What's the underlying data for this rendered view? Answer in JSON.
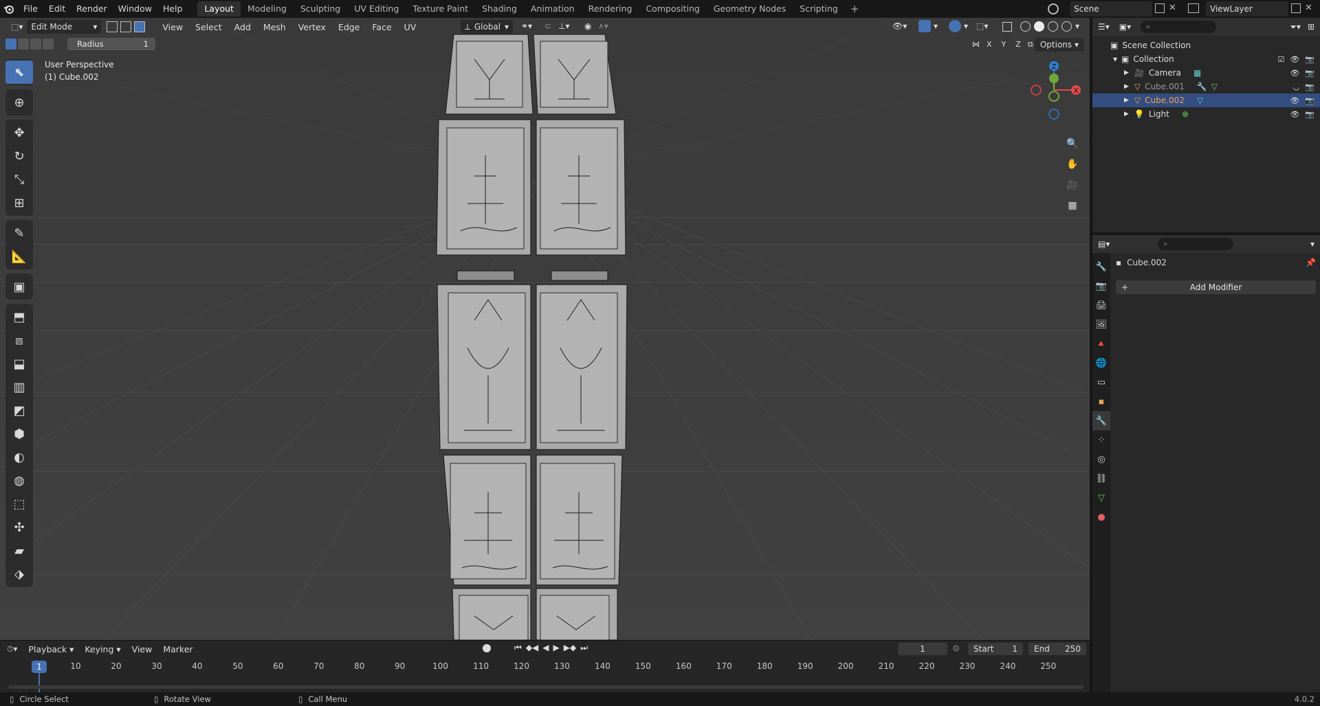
{
  "topbar": {
    "menus": [
      "File",
      "Edit",
      "Render",
      "Window",
      "Help"
    ],
    "workspaces": [
      "Layout",
      "Modeling",
      "Sculpting",
      "UV Editing",
      "Texture Paint",
      "Shading",
      "Animation",
      "Rendering",
      "Compositing",
      "Geometry Nodes",
      "Scripting"
    ],
    "active_workspace": "Layout",
    "scene": "Scene",
    "view_layer": "ViewLayer"
  },
  "viewport": {
    "mode": "Edit Mode",
    "menus": [
      "View",
      "Select",
      "Add",
      "Mesh",
      "Vertex",
      "Edge",
      "Face",
      "UV"
    ],
    "orientation": "Global",
    "radius_label": "Radius",
    "radius_value": "1",
    "perspective": "User Perspective",
    "object_info": "(1) Cube.002",
    "options_label": "Options",
    "axis_labels": {
      "x": "X",
      "y": "Y",
      "z": "Z"
    },
    "gizmo_labels": {
      "z": "Z",
      "x": "X"
    }
  },
  "timeline": {
    "menus": [
      "Playback",
      "Keying",
      "View",
      "Marker"
    ],
    "current_frame": "1",
    "start_label": "Start",
    "start_value": "1",
    "end_label": "End",
    "end_value": "250",
    "ticks": [
      "10",
      "20",
      "30",
      "40",
      "50",
      "60",
      "70",
      "80",
      "90",
      "100",
      "110",
      "120",
      "130",
      "140",
      "150",
      "160",
      "170",
      "180",
      "190",
      "200",
      "210",
      "220",
      "230",
      "240",
      "250"
    ]
  },
  "outliner": {
    "scene_collection": "Scene Collection",
    "collection": "Collection",
    "items": [
      {
        "label": "Camera",
        "style": "normal"
      },
      {
        "label": "Cube.001",
        "style": "dim"
      },
      {
        "label": "Cube.002",
        "style": "orange"
      },
      {
        "label": "Light",
        "style": "normal"
      }
    ]
  },
  "properties": {
    "object_name": "Cube.002",
    "add_modifier": "Add Modifier"
  },
  "statusbar": {
    "items": [
      "Circle Select",
      "Rotate View",
      "Call Menu"
    ],
    "version": "4.0.2"
  }
}
